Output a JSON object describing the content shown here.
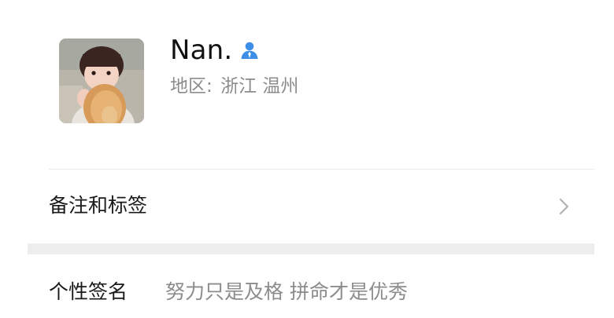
{
  "profile": {
    "name": "Nan.",
    "region_label": "地区:",
    "region_value": "浙江 温州",
    "gender_icon": "male-user-icon",
    "gender_icon_color": "#3d8ee6"
  },
  "rows": {
    "remark_label": "备注和标签",
    "remark_icon": "chevron-right-icon",
    "signature_label": "个性签名",
    "signature_value": "努力只是及格 拼命才是优秀"
  },
  "colors": {
    "divider": "#ebebeb",
    "spacer": "#ededed",
    "secondary_text": "#8c8c8c",
    "primary_text": "#1a1a1a"
  }
}
